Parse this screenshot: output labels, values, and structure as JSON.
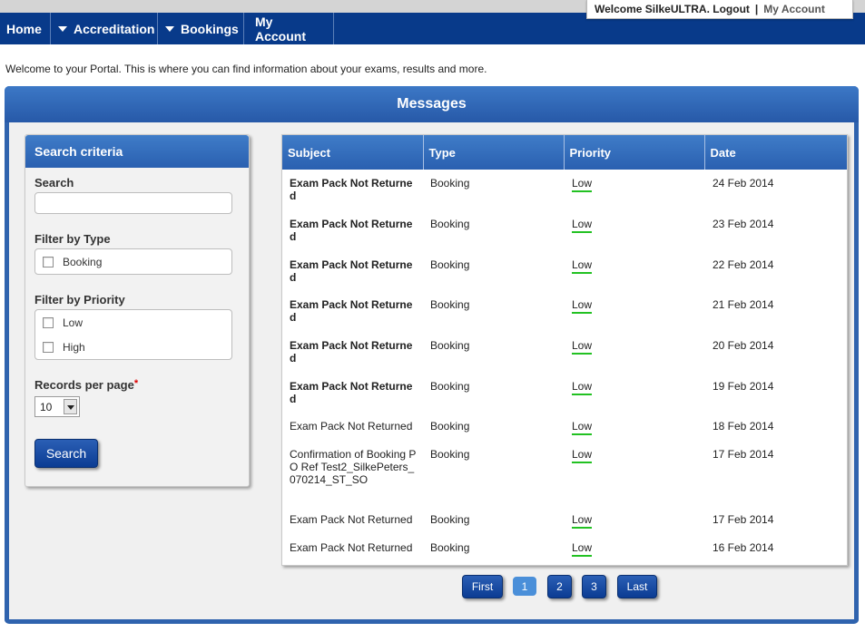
{
  "header": {
    "welcome_text": "Welcome SilkeULTRA. Logout",
    "separator": "|",
    "my_account": "My Account"
  },
  "nav": {
    "home": "Home",
    "accreditation": "Accreditation",
    "bookings": "Bookings",
    "my_account": "My Account"
  },
  "intro": "Welcome to your Portal. This is where you can find information about your exams, results and more.",
  "messages": {
    "title": "Messages"
  },
  "search": {
    "title": "Search criteria",
    "search_label": "Search",
    "search_value": "",
    "filter_type_label": "Filter by Type",
    "type_options": [
      "Booking"
    ],
    "filter_priority_label": "Filter by Priority",
    "priority_options": [
      "Low",
      "High"
    ],
    "records_label": "Records per page",
    "required_mark": "*",
    "records_value": "10",
    "search_button": "Search"
  },
  "table": {
    "columns": [
      "Subject",
      "Type",
      "Priority",
      "Date"
    ],
    "rows": [
      {
        "subject": "Exam Pack Not Returned",
        "bold": true,
        "type": "Booking",
        "priority": "Low",
        "date": "24 Feb 2014"
      },
      {
        "subject": "Exam Pack Not Returned",
        "bold": true,
        "type": "Booking",
        "priority": "Low",
        "date": "23 Feb 2014"
      },
      {
        "subject": "Exam Pack Not Returned",
        "bold": true,
        "type": "Booking",
        "priority": "Low",
        "date": "22 Feb 2014"
      },
      {
        "subject": "Exam Pack Not Returned",
        "bold": true,
        "type": "Booking",
        "priority": "Low",
        "date": "21 Feb 2014"
      },
      {
        "subject": "Exam Pack Not Returned",
        "bold": true,
        "type": "Booking",
        "priority": "Low",
        "date": "20 Feb 2014"
      },
      {
        "subject": "Exam Pack Not Returned",
        "bold": true,
        "type": "Booking",
        "priority": "Low",
        "date": "19 Feb 2014"
      },
      {
        "subject": "Exam Pack Not Returned",
        "bold": false,
        "type": "Booking",
        "priority": "Low",
        "date": "18 Feb 2014"
      },
      {
        "subject": "Confirmation of Booking PO Ref Test2_SilkePeters_070214_ST_SO",
        "bold": false,
        "type": "Booking",
        "priority": "Low",
        "date": "17 Feb 2014"
      },
      {
        "subject": "Exam Pack Not Returned",
        "bold": false,
        "type": "Booking",
        "priority": "Low",
        "date": "17 Feb 2014"
      },
      {
        "subject": "Exam Pack Not Returned",
        "bold": false,
        "type": "Booking",
        "priority": "Low",
        "date": "16 Feb 2014"
      }
    ]
  },
  "pagination": {
    "first": "First",
    "pages": [
      "1",
      "2",
      "3"
    ],
    "current": "1",
    "last": "Last"
  },
  "colors": {
    "nav_bg": "#083a8a",
    "panel_blue": "#2f63ae",
    "priority_low_underline": "#22c122"
  }
}
